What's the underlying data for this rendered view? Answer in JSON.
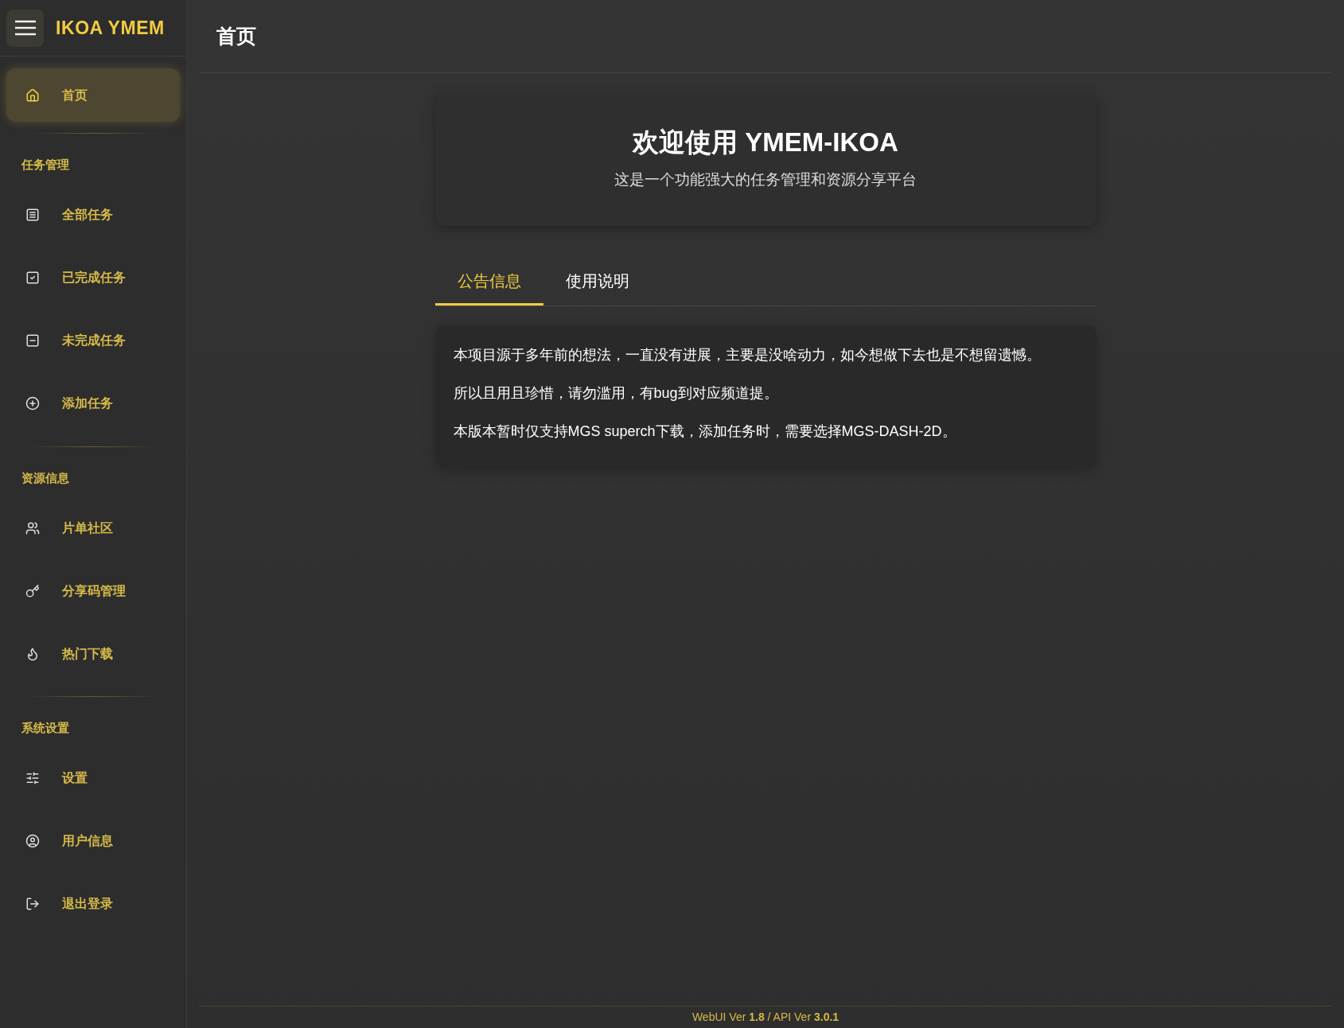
{
  "brand": "IKOA YMEM",
  "sidebar": {
    "items": [
      {
        "label": "首页",
        "kind": "home",
        "selected": true
      }
    ],
    "sections": [
      {
        "title": "任务管理",
        "items": [
          {
            "label": "全部任务",
            "kind": "list",
            "selected": false
          },
          {
            "label": "已完成任务",
            "kind": "check",
            "selected": false
          },
          {
            "label": "未完成任务",
            "kind": "minus",
            "selected": false
          },
          {
            "label": "添加任务",
            "kind": "plus",
            "selected": false
          }
        ]
      },
      {
        "title": "资源信息",
        "items": [
          {
            "label": "片单社区",
            "kind": "users",
            "selected": false
          },
          {
            "label": "分享码管理",
            "kind": "key",
            "selected": false
          },
          {
            "label": "热门下载",
            "kind": "fire",
            "selected": false
          }
        ]
      },
      {
        "title": "系统设置",
        "items": [
          {
            "label": "设置",
            "kind": "sliders",
            "selected": false
          },
          {
            "label": "用户信息",
            "kind": "user",
            "selected": false
          },
          {
            "label": "退出登录",
            "kind": "logout",
            "selected": false
          }
        ]
      }
    ]
  },
  "page_title": "首页",
  "welcome": {
    "title": "欢迎使用 YMEM-IKOA",
    "subtitle": "这是一个功能强大的任务管理和资源分享平台"
  },
  "tabs": [
    {
      "label": "公告信息",
      "selected": true
    },
    {
      "label": "使用说明",
      "selected": false
    }
  ],
  "notice": [
    "本项目源于多年前的想法，一直没有进展，主要是没啥动力，如今想做下去也是不想留遗憾。",
    "所以且用且珍惜，请勿滥用，有bug到对应频道提。",
    "本版本暂时仅支持MGS superch下载，添加任务时，需要选择MGS-DASH-2D。"
  ],
  "footer": "WebUI Ver **1.8** / API Ver **3.0.1**"
}
